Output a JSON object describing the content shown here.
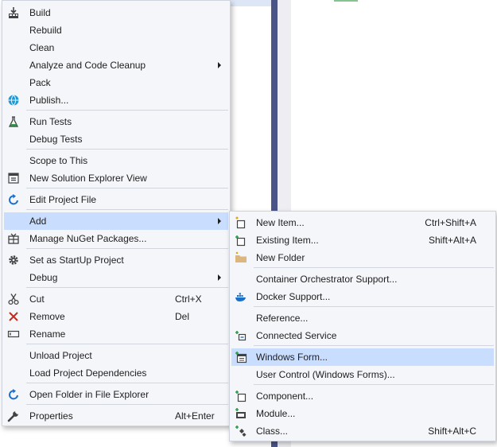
{
  "main_menu": {
    "items": [
      {
        "label": "Build",
        "icon": "build-icon"
      },
      {
        "label": "Rebuild"
      },
      {
        "label": "Clean"
      },
      {
        "label": "Analyze and Code Cleanup",
        "submenu": true
      },
      {
        "label": "Pack"
      },
      {
        "label": "Publish...",
        "icon": "globe-icon"
      },
      {
        "label": "Run Tests",
        "icon": "flask-icon"
      },
      {
        "label": "Debug Tests"
      },
      {
        "label": "Scope to This"
      },
      {
        "label": "New Solution Explorer View",
        "icon": "explorer-view-icon"
      },
      {
        "label": "Edit Project File",
        "icon": "edit-arrow-icon"
      },
      {
        "label": "Add",
        "submenu": true,
        "highlighted": true
      },
      {
        "label": "Manage NuGet Packages...",
        "icon": "nuget-icon"
      },
      {
        "label": "Set as StartUp Project",
        "icon": "gear-icon"
      },
      {
        "label": "Debug",
        "submenu": true
      },
      {
        "label": "Cut",
        "shortcut": "Ctrl+X",
        "icon": "scissors-icon"
      },
      {
        "label": "Remove",
        "shortcut": "Del",
        "icon": "red-x-icon"
      },
      {
        "label": "Rename",
        "icon": "rename-icon"
      },
      {
        "label": "Unload Project"
      },
      {
        "label": "Load Project Dependencies"
      },
      {
        "label": "Open Folder in File Explorer",
        "icon": "folder-arrow-icon"
      },
      {
        "label": "Properties",
        "shortcut": "Alt+Enter",
        "icon": "wrench-icon"
      }
    ]
  },
  "add_submenu": {
    "items": [
      {
        "label": "New Item...",
        "shortcut": "Ctrl+Shift+A",
        "icon": "new-item-icon"
      },
      {
        "label": "Existing Item...",
        "shortcut": "Shift+Alt+A",
        "icon": "existing-item-icon"
      },
      {
        "label": "New Folder",
        "icon": "new-folder-icon"
      },
      {
        "label": "Container Orchestrator Support..."
      },
      {
        "label": "Docker Support...",
        "icon": "docker-icon"
      },
      {
        "label": "Reference..."
      },
      {
        "label": "Connected Service",
        "icon": "connected-service-icon"
      },
      {
        "label": "Windows Form...",
        "icon": "windows-form-icon",
        "highlighted": true
      },
      {
        "label": "User Control (Windows Forms)..."
      },
      {
        "label": "Component...",
        "icon": "component-icon"
      },
      {
        "label": "Module...",
        "icon": "module-icon"
      },
      {
        "label": "Class...",
        "shortcut": "Shift+Alt+C",
        "icon": "class-icon"
      }
    ]
  },
  "colors": {
    "highlight": "#c9deff",
    "menu_bg": "#f5f6fa",
    "divider": "#4a5487",
    "remove_red": "#c42b1c",
    "accent_blue": "#1c6fc9"
  }
}
